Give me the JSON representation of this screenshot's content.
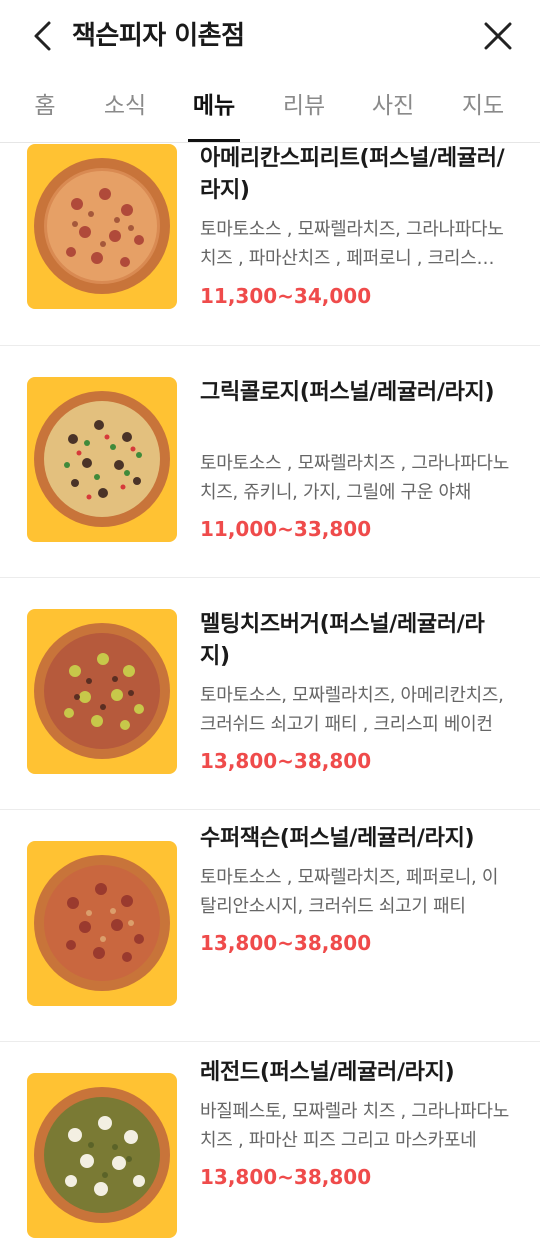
{
  "header": {
    "title": "잭슨피자 이촌점"
  },
  "tabs": [
    {
      "label": "홈",
      "active": false
    },
    {
      "label": "소식",
      "active": false
    },
    {
      "label": "메뉴",
      "active": true
    },
    {
      "label": "리뷰",
      "active": false
    },
    {
      "label": "사진",
      "active": false
    },
    {
      "label": "지도",
      "active": false
    }
  ],
  "menu": {
    "items": [
      {
        "name": "아메리칸스피리트(퍼스널/레귤러/라지)",
        "description": "토마토소스 , 모짜렐라치즈, 그라나파다노 치즈 , 파마산치즈 , 페퍼로니 , 크리스피 베이컨",
        "price": "11,300~34,000"
      },
      {
        "name": "그릭콜로지(퍼스널/레귤러/라지)",
        "description": "토마토소스 , 모짜렐라치즈 , 그라나파다노치즈, 쥬키니, 가지, 그릴에 구운 야채",
        "price": "11,000~33,800"
      },
      {
        "name": "멜팅치즈버거(퍼스널/레귤러/라지)",
        "description": "토마토소스, 모짜렐라치즈, 아메리칸치즈, 크러쉬드 쇠고기 패티 , 크리스피 베이컨",
        "price": "13,800~38,800"
      },
      {
        "name": "수퍼잭슨(퍼스널/레귤러/라지)",
        "description": "토마토소스 , 모짜렐라치즈, 페퍼로니, 이탈리안소시지, 크러쉬드 쇠고기 패티",
        "price": "13,800~38,800"
      },
      {
        "name": "레전드(퍼스널/레귤러/라지)",
        "description": "바질페스토, 모짜렐라 치즈 , 그라나파다노 치즈 , 파마산 피즈 그리고 마스카포네",
        "price": "13,800~38,800"
      }
    ]
  },
  "colors": {
    "thumb_background": "#ffc233",
    "price": "#ef4b4b",
    "active_tab": "#111111",
    "inactive_tab": "#8a8a8a"
  }
}
